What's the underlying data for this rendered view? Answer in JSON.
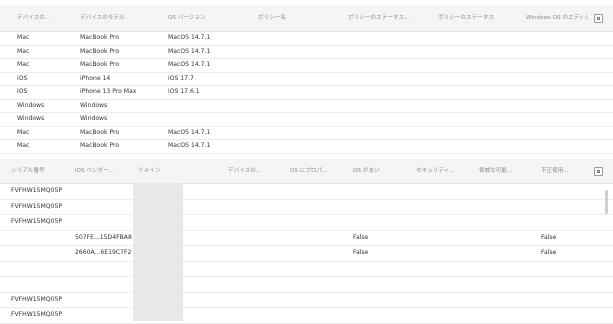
{
  "top_table": {
    "headers": [
      "デバイスの...",
      "デバイスのモデル",
      "OS バージョン",
      "ポリシー名",
      "ポリシーのステータス...",
      "ポリシーのステータス",
      "Windows OS のエディショ..."
    ],
    "rows": [
      [
        "Mac",
        "MacBook Pro",
        "MacOS 14.7.1"
      ],
      [
        "Mac",
        "MacBook Pro",
        "MacOS 14.7.1"
      ],
      [
        "Mac",
        "MacBook Pro",
        "MacOS 14.7.1"
      ],
      [
        "iOS",
        "iPhone 14",
        "iOS 17.7"
      ],
      [
        "iOS",
        "iPhone 13 Pro Max",
        "iOS 17.6.1"
      ],
      [
        "Windows",
        "Windows",
        ""
      ],
      [
        "Windows",
        "Windows",
        ""
      ],
      [
        "Mac",
        "MacBook Pro",
        "MacOS 14.7.1"
      ],
      [
        "Mac",
        "MacBook Pro",
        "MacOS 14.7.1"
      ]
    ]
  },
  "bottom_table": {
    "headers": [
      "シリアル番号",
      "iOS ベンダー...",
      "ドメイン",
      "デバイスの...",
      "OS にプロパ...",
      "OS がまい",
      "セキュリティ...",
      "脅威な可能...",
      "不正使用..."
    ],
    "rows": [
      [
        "FVFHW15MQ05P",
        "",
        "",
        "",
        "",
        "",
        "",
        "",
        ""
      ],
      [
        "FVFHW15MQ05P",
        "",
        "",
        "",
        "",
        "",
        "",
        "",
        ""
      ],
      [
        "FVFHW15MQ05P",
        "",
        "",
        "",
        "",
        "",
        "",
        "",
        ""
      ],
      [
        "",
        "507FE...15D4FBA8",
        "",
        "",
        "",
        "False",
        "",
        "",
        "False"
      ],
      [
        "",
        "2660A...6E19C7F2",
        "",
        "",
        "",
        "False",
        "",
        "",
        "False"
      ],
      [
        "",
        "",
        "",
        "",
        "",
        "",
        "",
        "",
        ""
      ],
      [
        "",
        "",
        "",
        "",
        "",
        "",
        "",
        "",
        ""
      ],
      [
        "FVFHW15MQ05P",
        "",
        "",
        "",
        "",
        "",
        "",
        "",
        ""
      ],
      [
        "FVFHW15MQ05P",
        "",
        "",
        "",
        "",
        "",
        "",
        "",
        ""
      ]
    ]
  },
  "icons": {
    "column_settings": "column-settings-icon"
  },
  "colors": {
    "header_bg": "#f5f5f5",
    "grid_line": "#ececec",
    "domain_column": "#e8e8e8"
  }
}
